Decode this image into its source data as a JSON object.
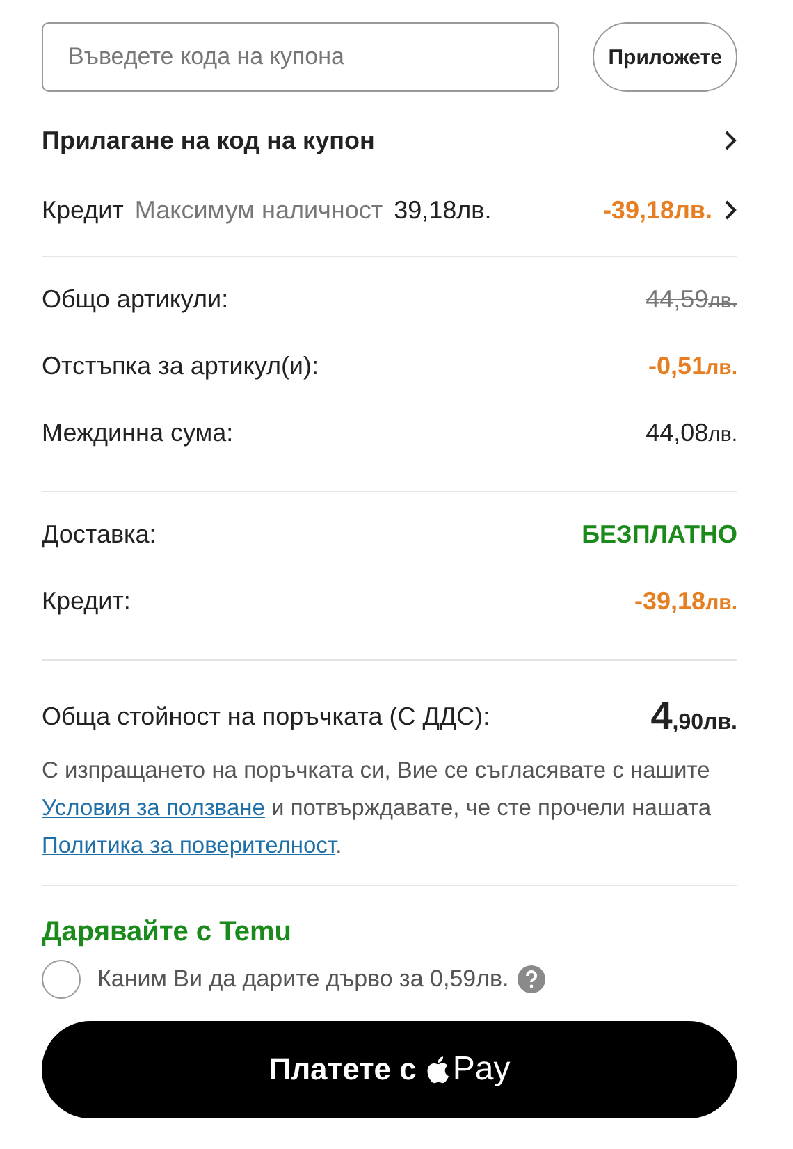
{
  "coupon": {
    "placeholder": "Въведете кода на купона",
    "apply_button": "Приложете"
  },
  "coupon_link": {
    "label": "Прилагане на код на купон"
  },
  "credit": {
    "label": "Кредит",
    "hint": "Максимум наличност",
    "available": "39,18лв.",
    "amount": "-39,18",
    "currency": "лв."
  },
  "summary_groups": [
    [
      {
        "label": "Общо артикули:",
        "amount": "44,59",
        "currency": "лв.",
        "kind": "strike"
      },
      {
        "label": "Отстъпка за артикул(и):",
        "amount": "-0,51",
        "currency": "лв.",
        "kind": "discount"
      },
      {
        "label": "Междинна сума:",
        "amount": "44,08",
        "currency": "лв.",
        "kind": "normal"
      }
    ],
    [
      {
        "label": "Доставка:",
        "amount": "БЕЗПЛАТНО",
        "kind": "free"
      },
      {
        "label": "Кредит:",
        "amount": "-39,18",
        "currency": "лв.",
        "kind": "discount"
      }
    ]
  ],
  "total": {
    "label": "Обща стойност на поръчката (С ДДС):",
    "whole": "4",
    "fraction": ",90",
    "currency": "лв."
  },
  "terms": [
    {
      "kind": "text",
      "text": "С изпращането на поръчката си, Вие се съгласявате с нашите "
    },
    {
      "kind": "link",
      "text": "Условия за ползване"
    },
    {
      "kind": "text",
      "text": " и потвърждавате, че сте прочели нашата "
    },
    {
      "kind": "link",
      "text": "Политика за поверителност"
    },
    {
      "kind": "text",
      "text": "."
    }
  ],
  "donation": {
    "title": "Дарявайте с Temu",
    "label": "Каним Ви да дарите дърво за 0,59лв.",
    "checked": false
  },
  "pay_button": {
    "label": "Платете с",
    "brand": "Pay"
  }
}
